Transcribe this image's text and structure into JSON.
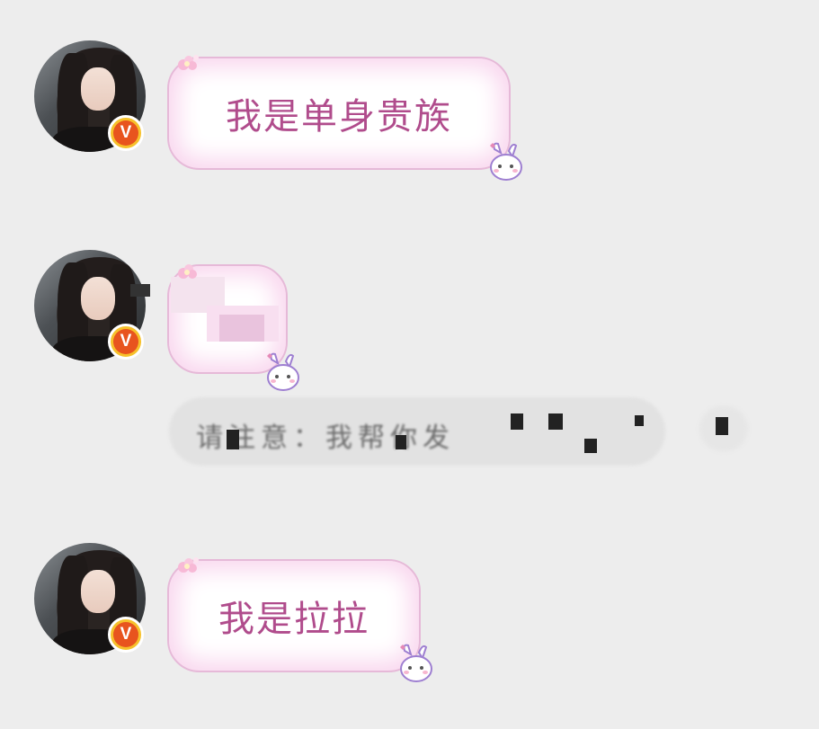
{
  "messages": [
    {
      "sender_badge": "V",
      "text": "我是单身贵族"
    },
    {
      "sender_badge": "V",
      "text": "",
      "notice": "请注意：我帮你发"
    },
    {
      "sender_badge": "V",
      "text": "我是拉拉"
    }
  ],
  "colors": {
    "background": "#ededed",
    "bubble_text": "#b04c8c",
    "bubble_border": "#e6b9d8",
    "badge_outer": "#f6c12b",
    "badge_inner": "#e8541e"
  },
  "icons": [
    "avatar",
    "verified-badge-icon",
    "flower-icon",
    "bunny-sticker-icon"
  ]
}
